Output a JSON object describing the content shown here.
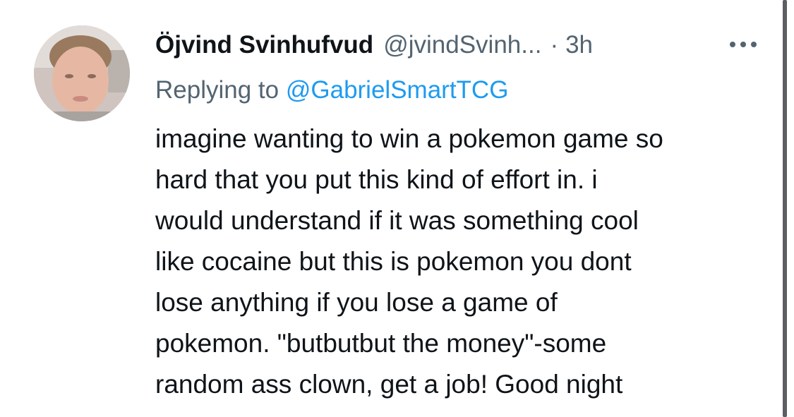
{
  "tweet": {
    "author_name": "Öjvind Svinhufvud",
    "author_handle": "@jvindSvinh...",
    "separator": "·",
    "time": "3h",
    "more_icon": "more-horizontal-icon",
    "replying_prefix": "Replying to",
    "replying_to": "@GabrielSmartTCG",
    "text_lines": [
      "imagine wanting to win a pokemon game so",
      "hard that you put this kind of effort in. i",
      "would understand if it was something cool",
      "like cocaine but this is pokemon you dont",
      "lose anything if you lose a game of",
      "pokemon. \"butbutbut the money\"-some",
      "random ass clown, get a job! Good night"
    ]
  },
  "colors": {
    "text": "#0f1419",
    "secondary": "#536471",
    "link": "#1d9bf0",
    "background": "#ffffff"
  }
}
